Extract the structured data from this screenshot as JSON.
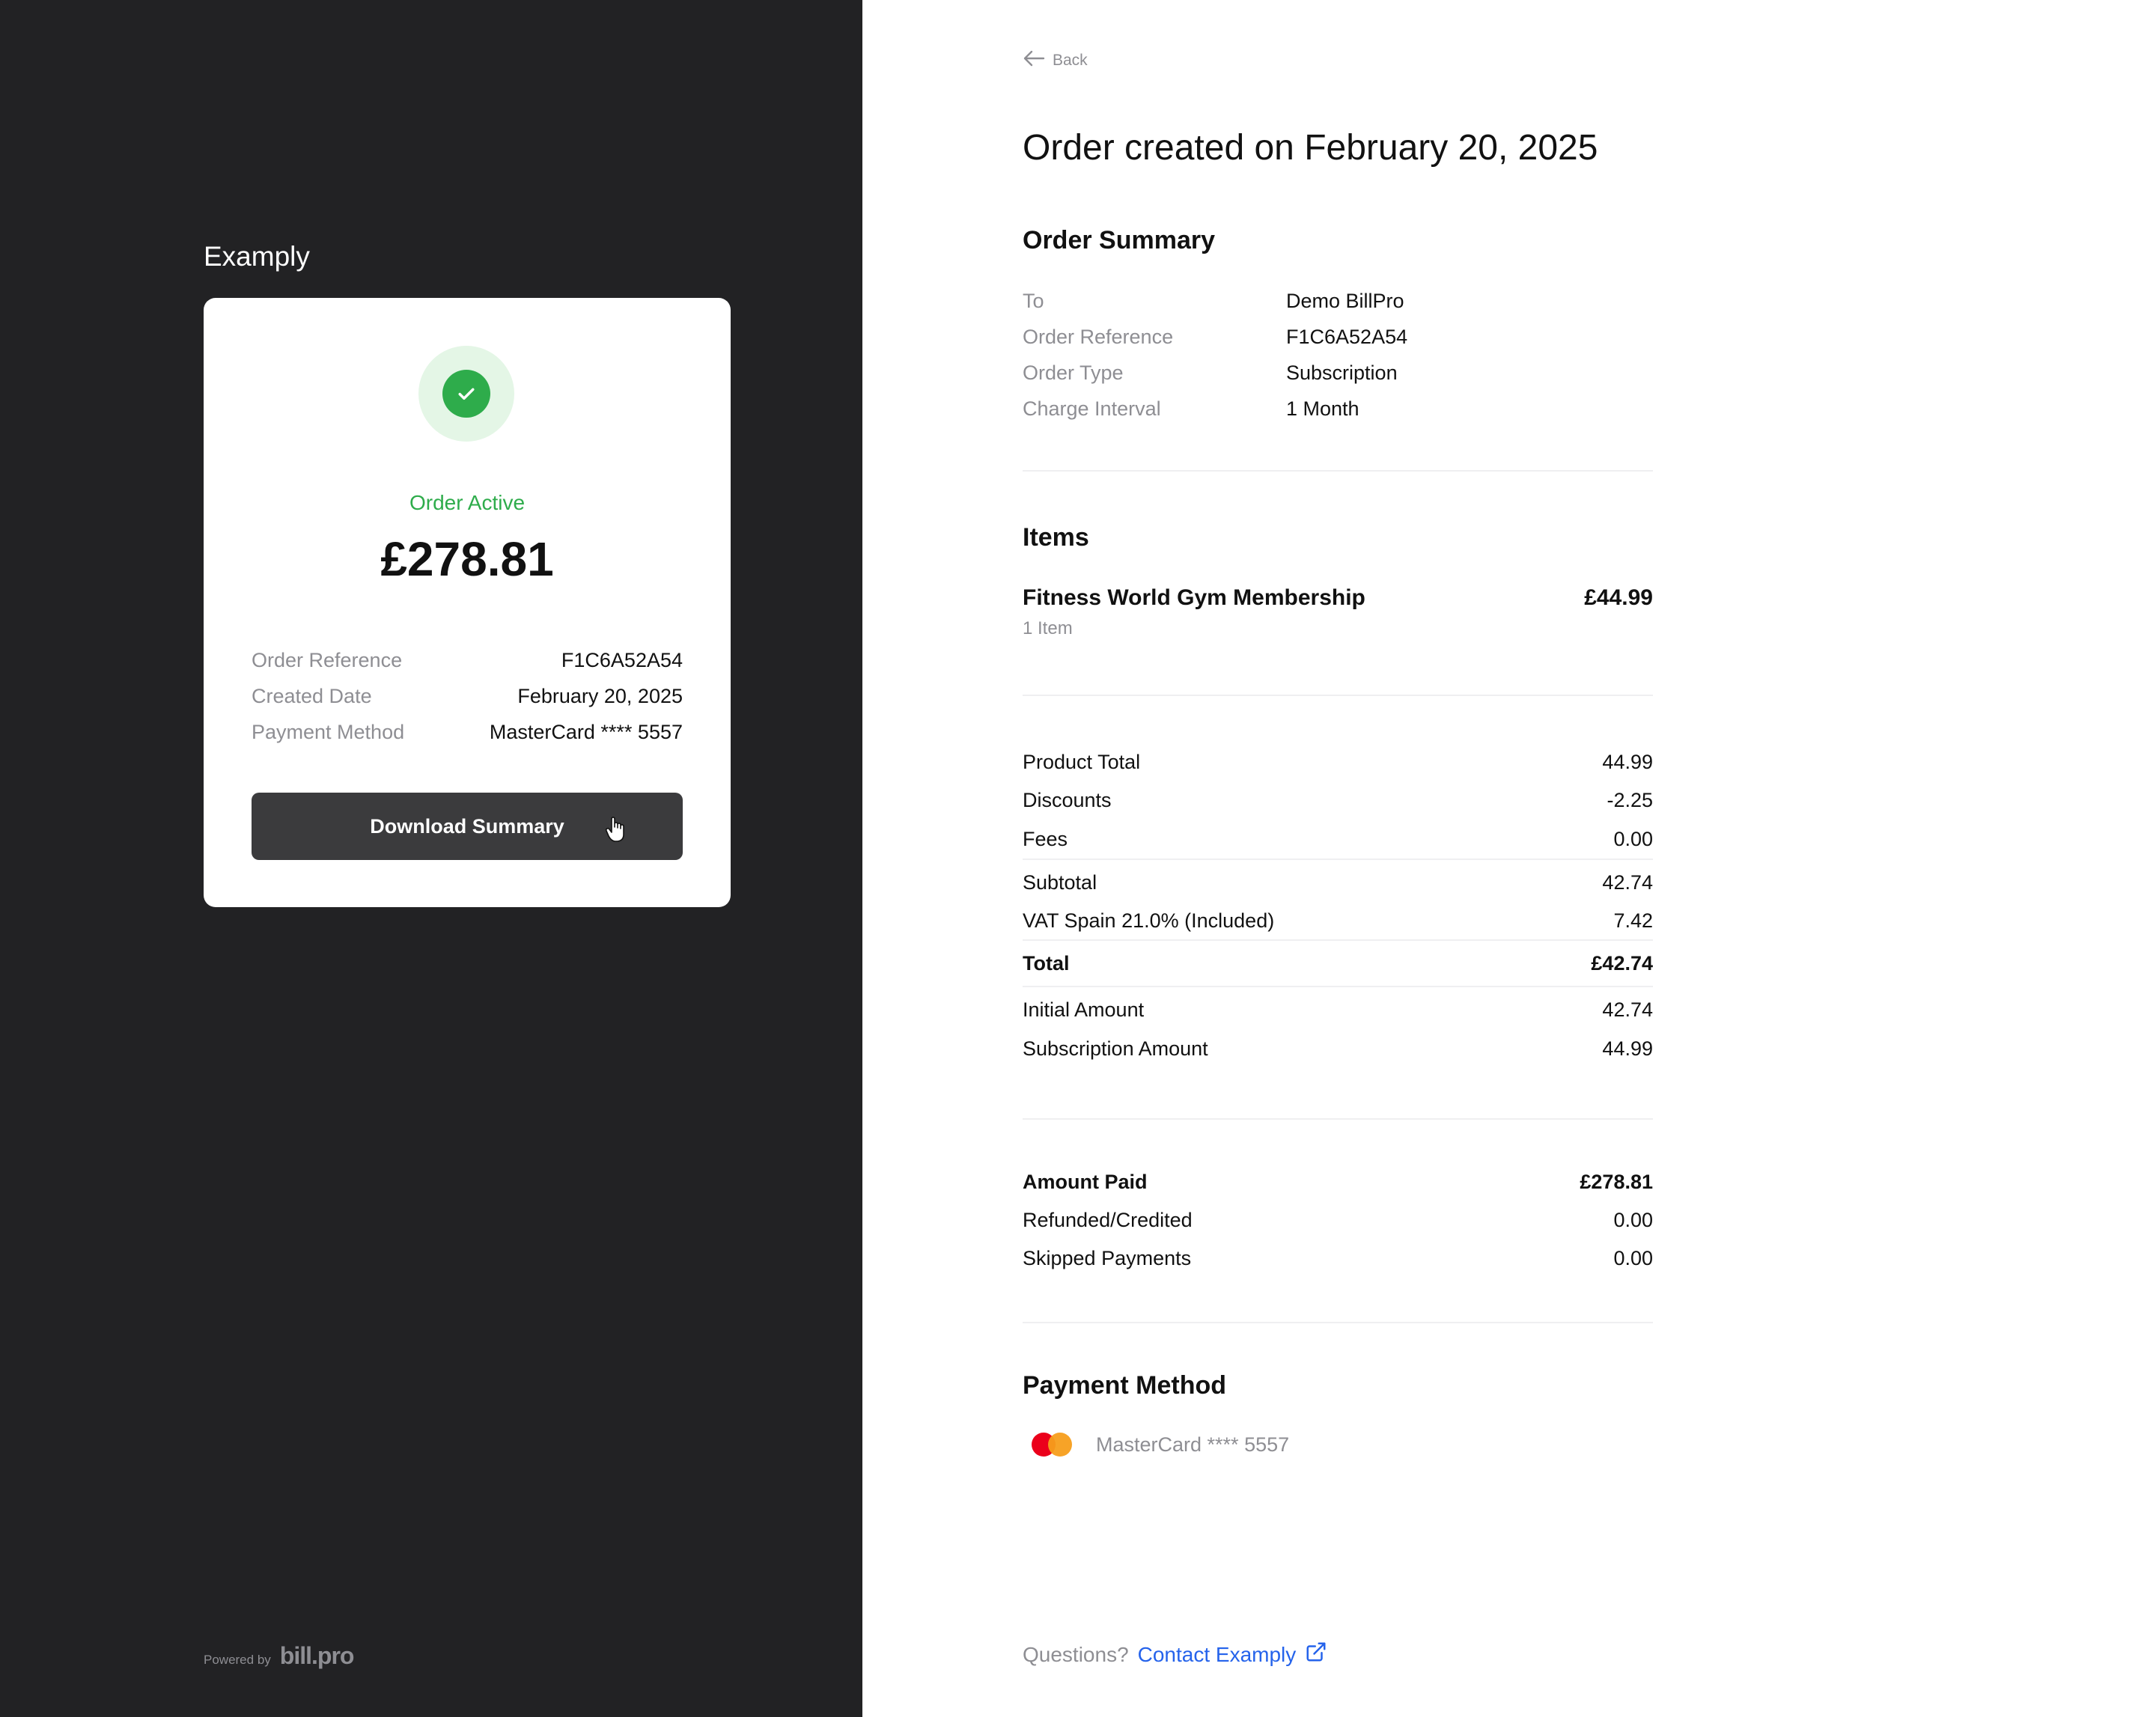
{
  "merchant": {
    "name": "Examply"
  },
  "card": {
    "status": "Order Active",
    "amount": "£278.81",
    "rows": [
      {
        "label": "Order Reference",
        "value": "F1C6A52A54"
      },
      {
        "label": "Created Date",
        "value": "February 20, 2025"
      },
      {
        "label": "Payment Method",
        "value": "MasterCard **** 5557"
      }
    ],
    "download_label": "Download Summary"
  },
  "powered": {
    "label": "Powered by",
    "logo": "bill.pro"
  },
  "back": {
    "label": "Back"
  },
  "title": "Order created on February 20, 2025",
  "order_summary": {
    "title": "Order Summary",
    "rows": [
      {
        "label": "To",
        "value": "Demo BillPro"
      },
      {
        "label": "Order Reference",
        "value": "F1C6A52A54"
      },
      {
        "label": "Order Type",
        "value": "Subscription"
      },
      {
        "label": "Charge Interval",
        "value": "1 Month"
      }
    ]
  },
  "items": {
    "title": "Items",
    "list": [
      {
        "name": "Fitness World Gym Membership",
        "price": "£44.99",
        "qty": "1 Item"
      }
    ]
  },
  "totals": {
    "product_total": {
      "label": "Product Total",
      "value": "44.99"
    },
    "discounts": {
      "label": "Discounts",
      "value": "-2.25"
    },
    "fees": {
      "label": "Fees",
      "value": "0.00"
    },
    "subtotal": {
      "label": "Subtotal",
      "value": "42.74"
    },
    "vat": {
      "label": "VAT Spain 21.0% (Included)",
      "value": "7.42"
    },
    "total": {
      "label": "Total",
      "value": "£42.74"
    },
    "initial": {
      "label": "Initial Amount",
      "value": "42.74"
    },
    "subscription": {
      "label": "Subscription Amount",
      "value": "44.99"
    }
  },
  "payments": {
    "amount_paid": {
      "label": "Amount Paid",
      "value": "£278.81"
    },
    "refunded": {
      "label": "Refunded/Credited",
      "value": "0.00"
    },
    "skipped": {
      "label": "Skipped Payments",
      "value": "0.00"
    }
  },
  "payment_method": {
    "title": "Payment Method",
    "card": "MasterCard **** 5557",
    "icon": "mastercard-icon"
  },
  "footer": {
    "question": "Questions?",
    "contact": "Contact Examply"
  },
  "colors": {
    "panel_dark": "#222224",
    "success": "#2eac4b",
    "link": "#2563eb",
    "button": "#3b3b3d"
  }
}
